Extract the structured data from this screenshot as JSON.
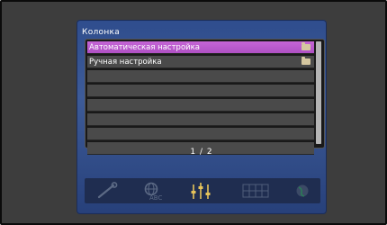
{
  "menu": {
    "title": "Колонка",
    "items": [
      {
        "label": "Автоматическая настройка",
        "selected": true,
        "icon": "folder-icon"
      },
      {
        "label": "Ручная настройка",
        "selected": false,
        "icon": "folder-icon"
      }
    ],
    "empty_rows": 6,
    "page_indicator": "1 / 2"
  },
  "toolbar": {
    "icons": [
      "wrench-icon",
      "language-abc-icon",
      "equalizer-icon",
      "grid-icon",
      "globe-icon"
    ],
    "active": "equalizer-icon"
  },
  "colors": {
    "screen_bg": "#3d3d3d",
    "panel_bg": "#3d5b98",
    "selection": "#c565d6",
    "row_bg": "#4a4a4a"
  }
}
